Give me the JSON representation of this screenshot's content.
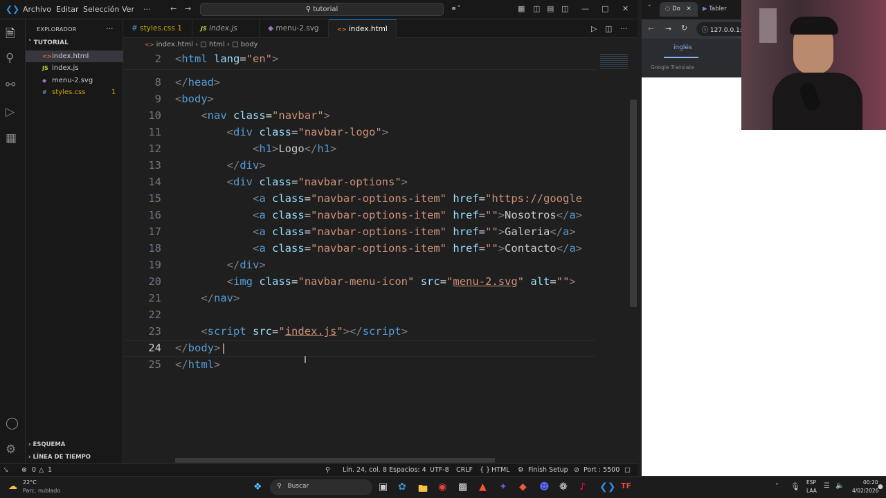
{
  "titlebar": {
    "menus": [
      "Archivo",
      "Editar",
      "Selección",
      "Ver"
    ],
    "search_text": "tutorial"
  },
  "sidebar": {
    "header": "EXPLORADOR",
    "folder": "TUTORIAL",
    "files": [
      {
        "name": "index.html",
        "badge": ""
      },
      {
        "name": "index.js",
        "badge": ""
      },
      {
        "name": "menu-2.svg",
        "badge": ""
      },
      {
        "name": "styles.css",
        "badge": "1"
      }
    ],
    "bottom_sections": [
      "ESQUEMA",
      "LÍNEA DE TIEMPO"
    ]
  },
  "tabs": [
    {
      "label": "styles.css",
      "badge": "1"
    },
    {
      "label": "index.js"
    },
    {
      "label": "menu-2.svg"
    },
    {
      "label": "index.html"
    }
  ],
  "breadcrumb": [
    "index.html",
    "html",
    "body"
  ],
  "editor": {
    "line_numbers": [
      "2",
      "8",
      "9",
      "10",
      "11",
      "12",
      "13",
      "14",
      "15",
      "16",
      "17",
      "18",
      "19",
      "20",
      "21",
      "22",
      "23",
      "24",
      "25"
    ],
    "current_line": "24"
  },
  "statusbar": {
    "errors": "0",
    "warnings": "1",
    "position": "Lín. 24, col. 8",
    "spaces": "Espacios: 4",
    "encoding": "UTF-8",
    "eol": "CRLF",
    "language": "HTML",
    "finish_setup": "Finish Setup",
    "port": "Port : 5500"
  },
  "browser": {
    "tab1": "Do",
    "tab2": "Tabler",
    "address": "127.0.0.1:",
    "translate_lang": "inglés",
    "translate_label": "Google Translate"
  },
  "taskbar": {
    "weather_temp": "22°C",
    "weather_desc": "Parc. nublado",
    "search_label": "Buscar",
    "lang": "ESP",
    "lang2": "LAA",
    "time": "00:20",
    "date": "4/02/2026"
  },
  "colors": {
    "accent": "#0078d4",
    "editor_bg": "#1f1f1f",
    "tag": "#569cd6",
    "attr": "#9cdcfe",
    "string": "#ce9178"
  }
}
